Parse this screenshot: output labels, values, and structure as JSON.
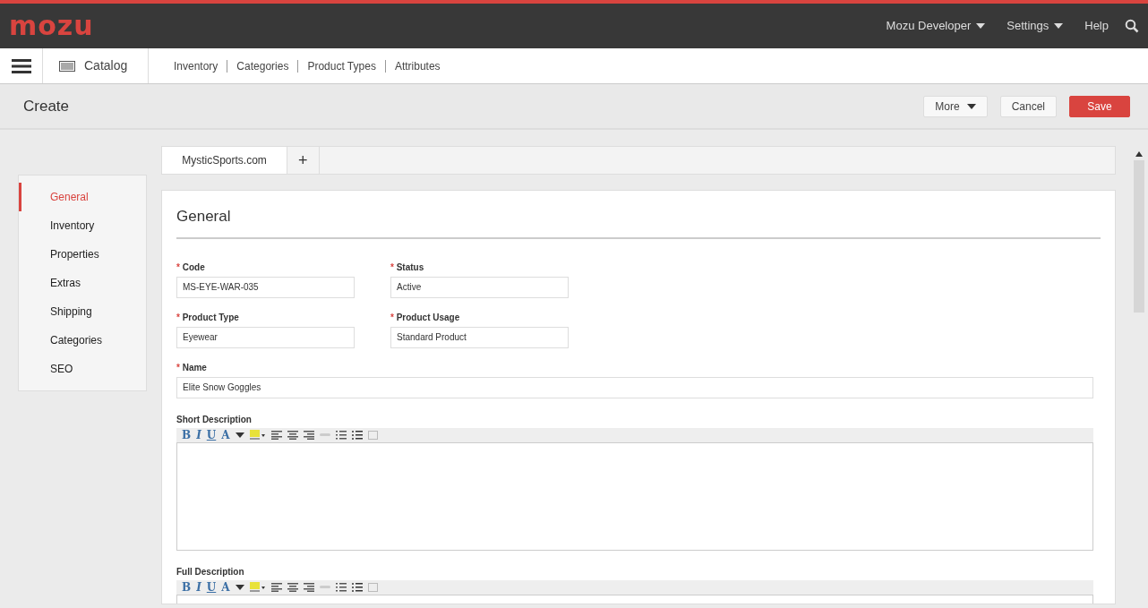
{
  "header": {
    "logo": "mozu",
    "menus": [
      {
        "label": "Mozu Developer",
        "dropdown": true
      },
      {
        "label": "Settings",
        "dropdown": true
      },
      {
        "label": "Help",
        "dropdown": false
      }
    ]
  },
  "subnav": {
    "section": "Catalog",
    "links": [
      "Inventory",
      "Categories",
      "Product Types",
      "Attributes"
    ]
  },
  "page": {
    "title": "Create",
    "buttons": [
      {
        "label": "More",
        "kind": "dropdown"
      },
      {
        "label": "Cancel",
        "kind": "default"
      },
      {
        "label": "Save",
        "kind": "primary"
      }
    ]
  },
  "sidebar": {
    "items": [
      {
        "label": "General",
        "selected": true
      },
      {
        "label": "Inventory",
        "selected": false
      },
      {
        "label": "Properties",
        "selected": false
      },
      {
        "label": "Extras",
        "selected": false
      },
      {
        "label": "Shipping",
        "selected": false
      },
      {
        "label": "Categories",
        "selected": false
      },
      {
        "label": "SEO",
        "selected": false
      }
    ]
  },
  "site_tabs": [
    {
      "label": "MysticSports.com",
      "selected": true
    },
    {
      "label": "+",
      "selected": false
    }
  ],
  "section_title": "General",
  "field_rows": [
    [
      {
        "required_mark": "*",
        "label": "Code",
        "value": "MS-EYE-WAR-035"
      },
      {
        "required_mark": "*",
        "label": "Status",
        "value": "Active"
      }
    ],
    [
      {
        "required_mark": "*",
        "label": "Product Type",
        "value": "Eyewear"
      },
      {
        "required_mark": "*",
        "label": "Product Usage",
        "value": "Standard Product"
      }
    ],
    [
      {
        "required_mark": "*",
        "label": "Name",
        "value": "Elite Snow Goggles"
      }
    ]
  ],
  "editors": [
    {
      "label": "Short Description",
      "toolbar_text": [
        "B",
        "I",
        "U",
        "A"
      ]
    },
    {
      "label": "Full Description",
      "toolbar_text": [
        "B",
        "I",
        "U",
        "A"
      ]
    }
  ]
}
